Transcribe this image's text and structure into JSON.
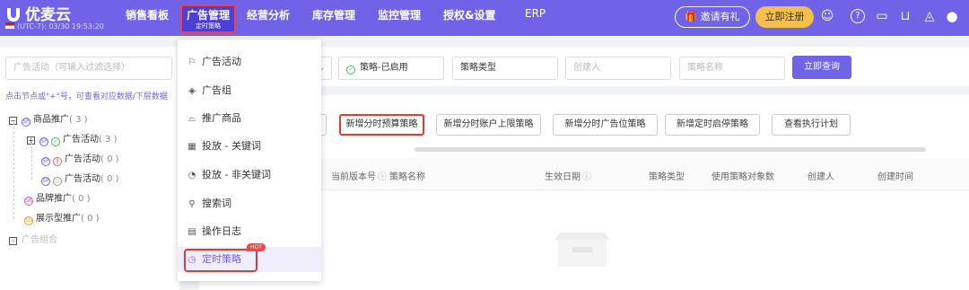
{
  "brand": {
    "name": "优麦云",
    "timezone": "(UTC-7): 03/30 19:53:20"
  },
  "nav": [
    {
      "label": "销售看板"
    },
    {
      "label": "广告管理",
      "sub": "定时策略"
    },
    {
      "label": "经营分析"
    },
    {
      "label": "库存管理"
    },
    {
      "label": "监控管理"
    },
    {
      "label": "授权&设置"
    },
    {
      "label": "ERP"
    }
  ],
  "topbar": {
    "invite_label": "邀请有礼",
    "register_label": "立即注册"
  },
  "tree": {
    "search_placeholder": "广告活动（可输入过滤选择）",
    "hint": "点击节点或\"+\"号，可查看对应数据/下层数据",
    "nodes": [
      {
        "label": "商品推广",
        "count": "( 3 )"
      },
      {
        "label": "广告活动",
        "count": "( 3 )"
      },
      {
        "label": "广告活动",
        "count": "( 0 )"
      },
      {
        "label": "广告活动",
        "count": "( 0 )"
      },
      {
        "label": "品牌推广",
        "count": "( 0 )"
      },
      {
        "label": "展示型推广",
        "count": "( 0 )"
      },
      {
        "label": "广告组合"
      }
    ]
  },
  "filters": {
    "status_value": "策略-已启用",
    "type_value": "策略类型",
    "creator_placeholder": "创建人",
    "name_placeholder": "策略名称",
    "query_label": "立即查询"
  },
  "actions": [
    "新增分时预算策略",
    "新增分时账户上限策略",
    "新增分时广告位策略",
    "新增定时启停策略",
    "查看执行计划"
  ],
  "table": {
    "columns": [
      "当前版本号",
      "策略名称",
      "生效日期",
      "策略类型",
      "使用策略对象数",
      "创建人",
      "创建时间"
    ]
  },
  "menu": {
    "items": [
      {
        "label": "广告活动",
        "icon": "flag-icon"
      },
      {
        "label": "广告组",
        "icon": "layers-icon"
      },
      {
        "label": "推广商品",
        "icon": "product-icon"
      },
      {
        "label": "投放 - 关键词",
        "icon": "keyword-icon"
      },
      {
        "label": "投放 - 非关键词",
        "icon": "target-icon"
      },
      {
        "label": "搜索词",
        "icon": "search-icon"
      },
      {
        "label": "操作日志",
        "icon": "log-icon"
      },
      {
        "label": "定时策略",
        "icon": "clock-icon",
        "badge": "HOT"
      }
    ]
  },
  "colors": {
    "accent": "#6f64e8",
    "highlight": "#e53935",
    "register": "#f5c04a"
  }
}
